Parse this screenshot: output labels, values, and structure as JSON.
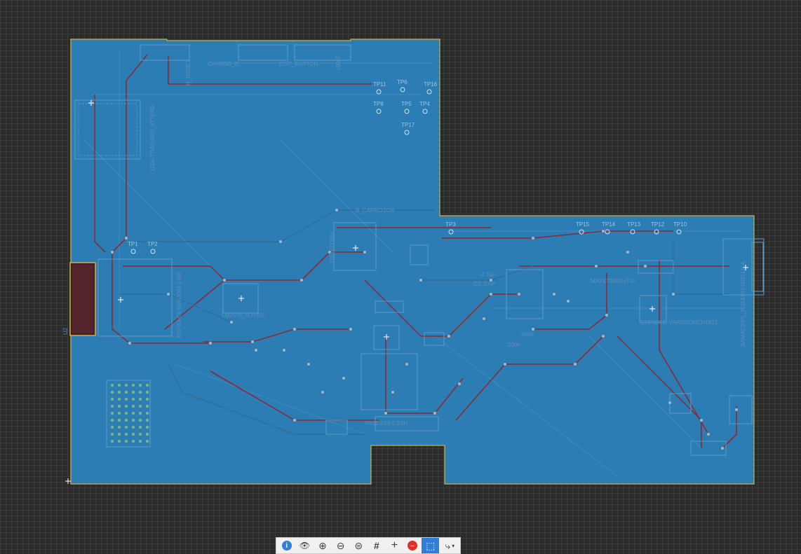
{
  "board": {
    "colors": {
      "background": "#2b2b2b",
      "copper": "#2d7db5",
      "trace_top": "#8a2a36",
      "trace_bottom": "#2c6f9a",
      "silkscreen": "#5a8fb8",
      "outline": "#c8b34a"
    },
    "component_labels": {
      "change_button": "CHANGE_B",
      "edit_button": "EDIT_BUTTON",
      "r_reset": "R_RESET",
      "cap_100nf_top": "100nF",
      "module_ts": "112A-TOAS-R03_ATTEND",
      "capacitor": "B_CAPACITOR",
      "ic_main": "DS3231SN#",
      "u2": "U2",
      "esp32": "ESP32-C6-WROOM-1-N8",
      "lm2576": "LM2576_5LIVEIC",
      "max17048": "MAX17048G+T10",
      "varistor": "ESP32C6_VARISTORCN1812",
      "usb_connector": "SAMACSYS_10118193-0001LF-A",
      "c2": "C2_CAP",
      "cap_47uf": "4.7uF",
      "res_100k": "100k",
      "pwr": "PWR",
      "fh_conn": "FH12-24S-0.5SH"
    },
    "test_points": [
      "TP1",
      "TP2",
      "TP4",
      "TP5",
      "TP6",
      "TP8",
      "TP10",
      "TP11",
      "TP12",
      "TP13",
      "TP14",
      "TP15",
      "TP16",
      "TP17",
      "TP3"
    ]
  },
  "toolbar": {
    "buttons": [
      {
        "name": "info-button",
        "icon": "info-icon",
        "glyph": "i"
      },
      {
        "name": "view-button",
        "icon": "eye-icon",
        "glyph": "👁"
      },
      {
        "name": "zoom-in-button",
        "icon": "zoom-in-icon",
        "glyph": "⊕"
      },
      {
        "name": "zoom-out-button",
        "icon": "zoom-out-icon",
        "glyph": "⊖"
      },
      {
        "name": "zoom-fit-button",
        "icon": "zoom-fit-icon",
        "glyph": "⊜"
      },
      {
        "name": "grid-button",
        "icon": "grid-icon",
        "glyph": "#"
      },
      {
        "name": "crosshair-button",
        "icon": "crosshair-icon",
        "glyph": "+"
      },
      {
        "name": "stop-button",
        "icon": "stop-icon",
        "glyph": "–"
      },
      {
        "name": "select-button",
        "icon": "select-icon",
        "glyph": "⬚"
      },
      {
        "name": "route-button",
        "icon": "route-icon",
        "glyph": "⤷"
      }
    ]
  }
}
